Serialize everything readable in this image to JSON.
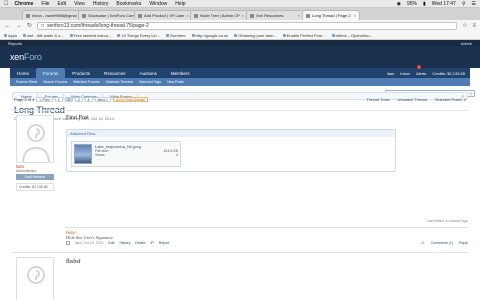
{
  "menubar": {
    "items": [
      "Chrome",
      "File",
      "Edit",
      "View",
      "History",
      "Bookmarks",
      "Window",
      "Help"
    ],
    "battery": "95%",
    "clock": "Wed 17:47"
  },
  "tabs": [
    {
      "label": "Inbox - rawel9988@gmai"
    },
    {
      "label": "Showcase | XenForo Com"
    },
    {
      "label": "Add Product | XF Liam"
    },
    {
      "label": "Node Tree | Admin CP"
    },
    {
      "label": "Xen Resources"
    },
    {
      "label": "Long Thread | Page 2"
    }
  ],
  "tab_user": "",
  "address": {
    "url": "xenforo13.com/threads/long-thread.75/page-2"
  },
  "bookmarks": [
    "Apps",
    "wst - rfdt water & s...",
    "Free student haircu...",
    "10 Things Every Lin...",
    "Gumtree",
    "http://google.co.uk",
    "Obtaining pure adm...",
    "Enable Perfect Fore...",
    "reflect – Openvbou..."
  ],
  "admin_bar": {
    "left": "Reports",
    "right": "Admin"
  },
  "site": {
    "logo_a": "xen",
    "logo_b": "Foro"
  },
  "nav": {
    "tabs": [
      "Home",
      "Forums",
      "Products",
      "Resources",
      "Auctions",
      "Members"
    ],
    "right": [
      "liam",
      "Inbox",
      "Alerts",
      "Credits: $2,135.65"
    ],
    "alerts_count": "1"
  },
  "subnav": [
    "Forums Read",
    "Search Forums",
    "Watched Forums",
    "Watched Threads",
    "Watched Tags",
    "New Posts"
  ],
  "search": {
    "placeholder": "Search..."
  },
  "breadcrumb": [
    "Home",
    "Forums",
    "Main Category",
    "Main Forum"
  ],
  "thread": {
    "title": "Long Thread",
    "meta": "Discussion in 'Main Forum' started by liam, Oct 15, 2014.",
    "page_label": "Page 2 of 4",
    "pages": [
      "< Prev",
      "1",
      "2",
      "3",
      "4",
      "Next >",
      "Go to First Unread"
    ],
    "tools": [
      "Thread Tools",
      "Unwatch Thread",
      "Selected Posts: 0"
    ]
  },
  "post1": {
    "username": "liam",
    "user_title": "Administrator",
    "staff": "Staff Member",
    "credits": "Credits: $2,135.65",
    "title": "First Post",
    "attached_label": "Attached Files:",
    "file_name": "Lake_majouruha_N2.jpeg",
    "file_size_label": "File size:",
    "file_size": "514.5 KB",
    "views_label": "Views:",
    "views": "4",
    "last_edited": "Last edited: a moment ago",
    "sig_hello": "Hello!",
    "sig_text": "Hide this User's Signature",
    "footer_user": "liam, Oct 15, 2014",
    "actions": [
      "Edit",
      "History",
      "Delete",
      "IP",
      "Report"
    ],
    "post_no": "#1",
    "comments": "Comments (1)",
    "reply": "Reply"
  },
  "post2": {
    "title": "fbsbsf"
  }
}
